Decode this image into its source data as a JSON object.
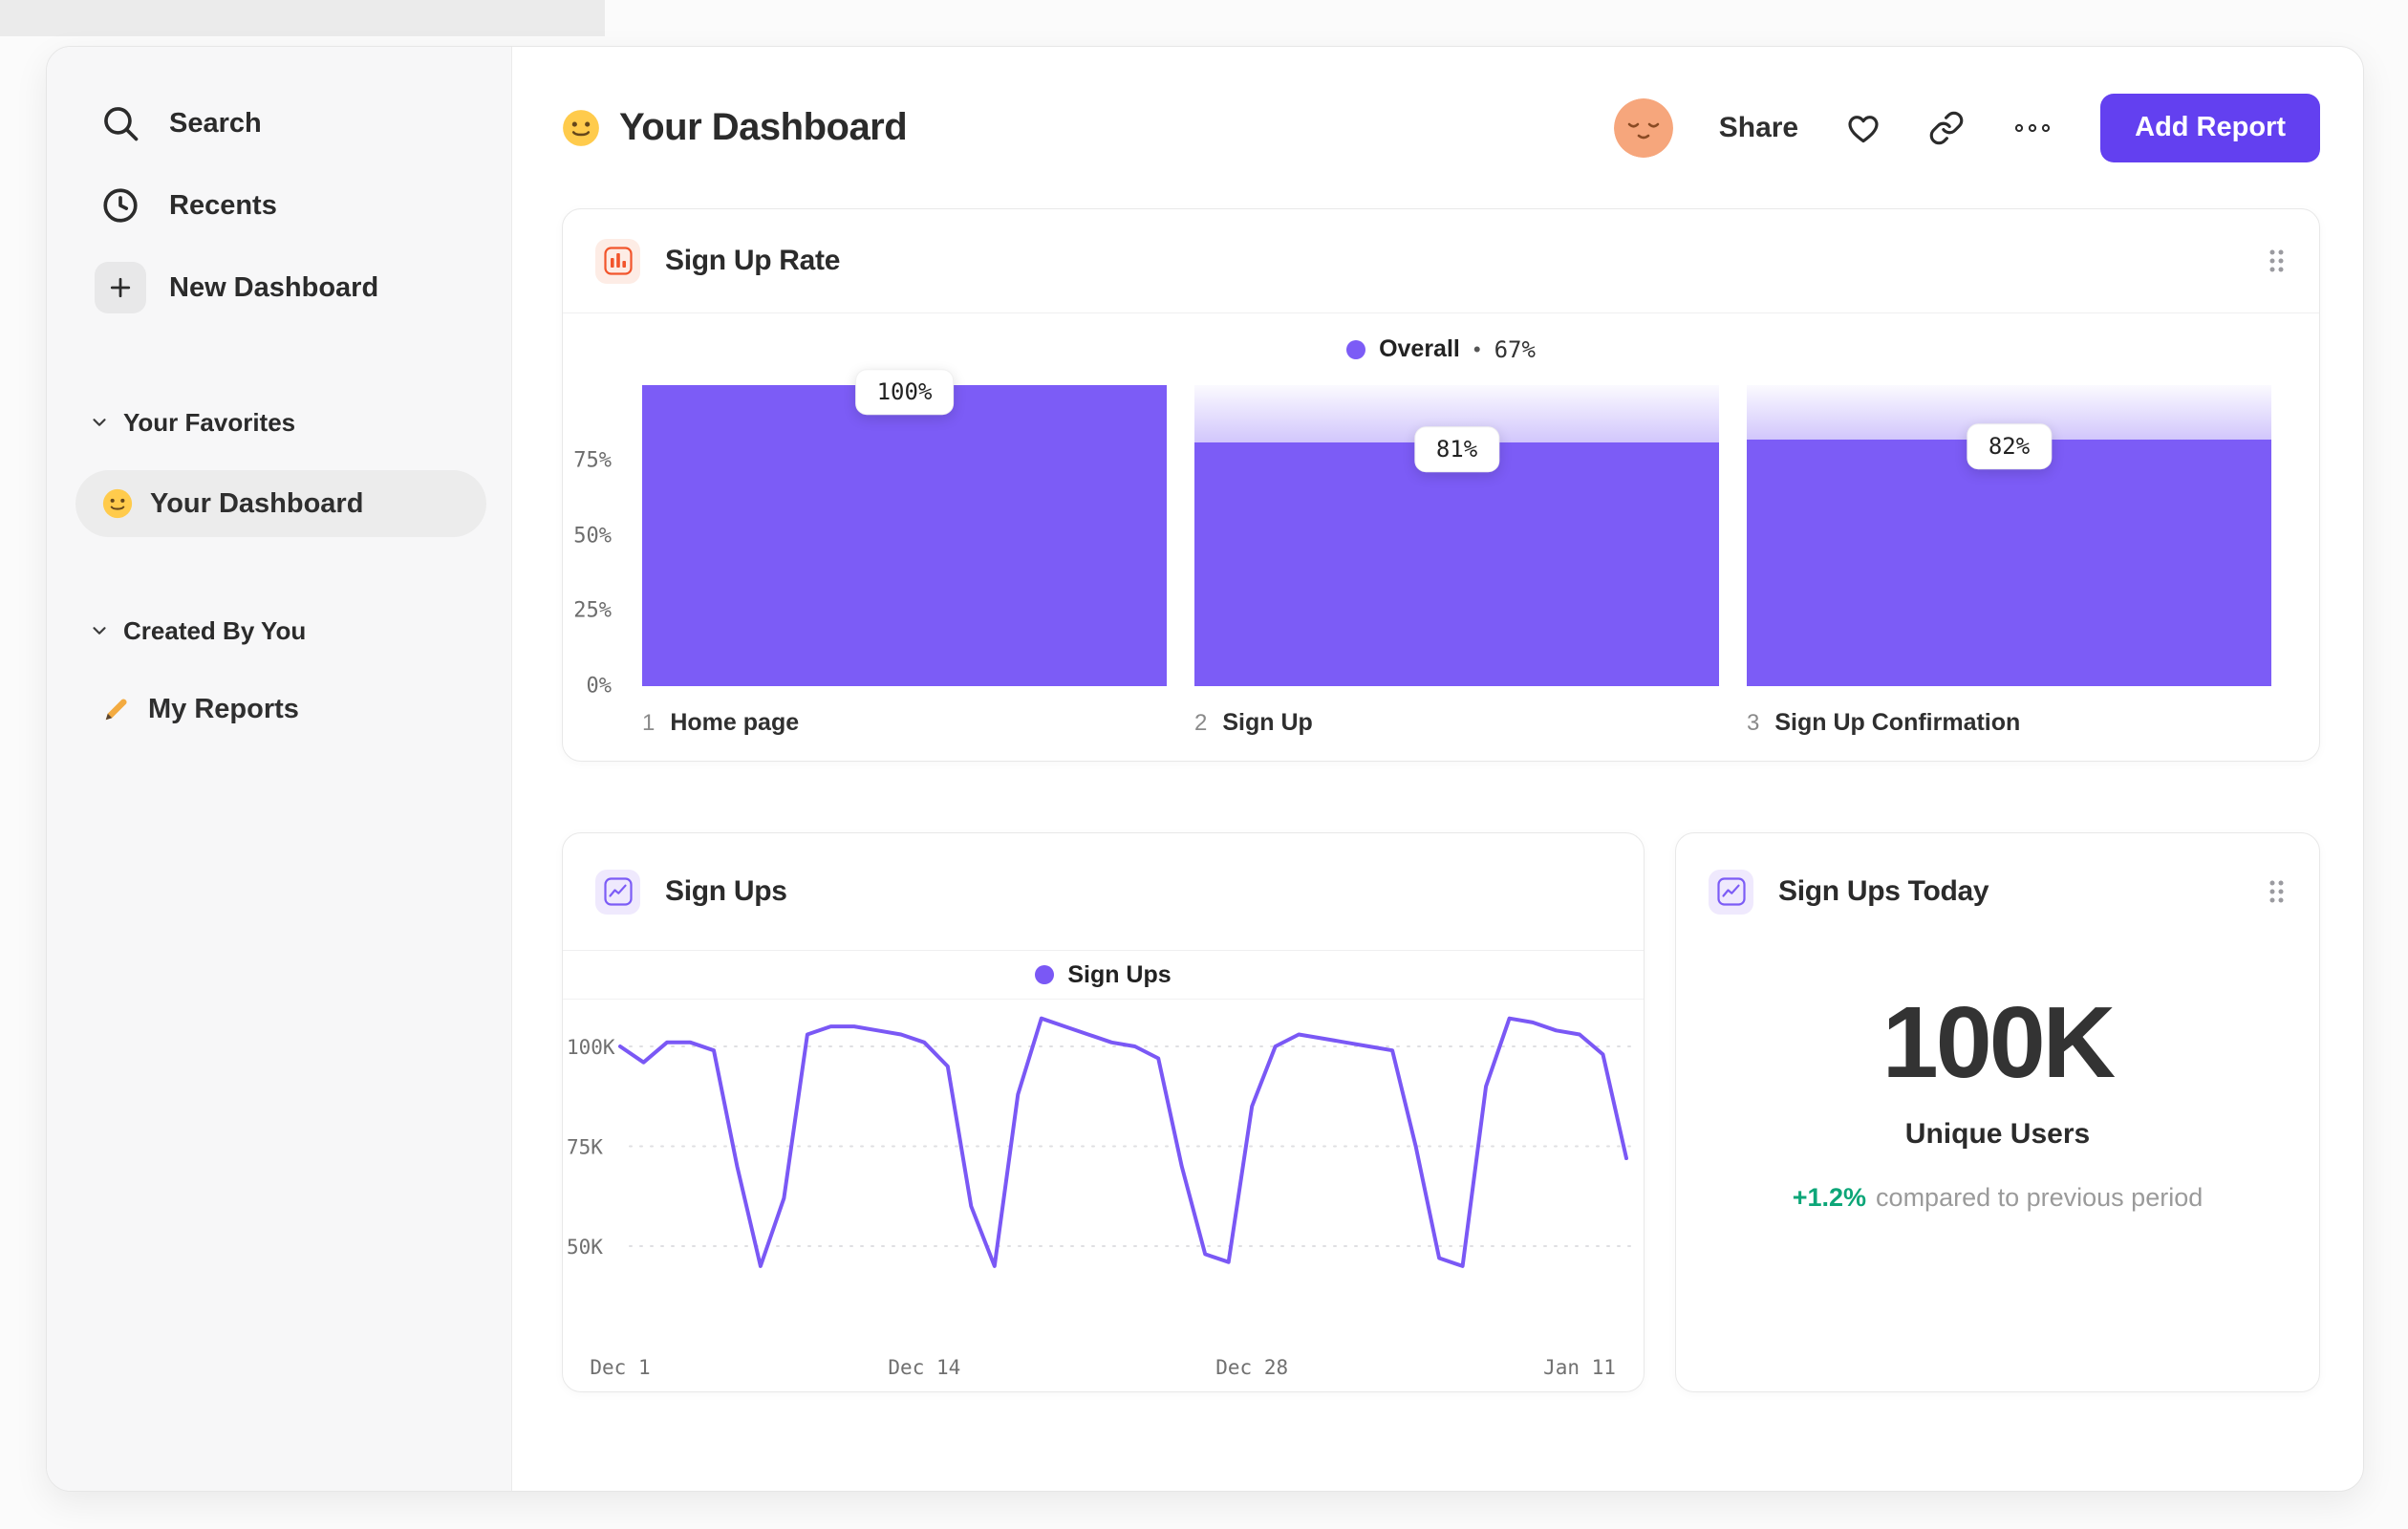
{
  "header": {
    "emoji": "🙂",
    "title": "Your Dashboard",
    "share_label": "Share",
    "add_report_label": "Add Report"
  },
  "sidebar": {
    "nav": [
      {
        "icon": "search-icon",
        "label": "Search"
      },
      {
        "icon": "clock-icon",
        "label": "Recents"
      },
      {
        "icon": "plus-icon",
        "label": "New Dashboard"
      }
    ],
    "sections": [
      {
        "title": "Your Favorites",
        "items": [
          {
            "emoji": "🙂",
            "label": "Your Dashboard",
            "selected": true
          }
        ]
      },
      {
        "title": "Created By You",
        "items": [
          {
            "emoji": "✏️",
            "label": "My Reports",
            "selected": false
          }
        ]
      }
    ]
  },
  "colors": {
    "accent_purple": "#7c5cf6",
    "button_purple": "#6340f0",
    "icon_orange": "#f2552c",
    "delta_green": "#0da678"
  },
  "chart_data": [
    {
      "type": "bar",
      "title": "Sign Up Rate",
      "legend_label": "Overall",
      "legend_separator": "•",
      "legend_value": "67%",
      "categories": [
        "Home page",
        "Sign Up",
        "Sign Up Confirmation"
      ],
      "category_indices": [
        "1",
        "2",
        "3"
      ],
      "values": [
        100,
        81,
        82
      ],
      "value_labels": [
        "100%",
        "81%",
        "82%"
      ],
      "y_ticks": [
        "75%",
        "50%",
        "25%",
        "0%"
      ],
      "ylim": [
        0,
        100
      ],
      "bar_color": "#7c5cf6",
      "legend_position": "top-center",
      "grid": false
    },
    {
      "type": "line",
      "title": "Sign Ups",
      "legend_label": "Sign Ups",
      "x_ticks": [
        "Dec 1",
        "Dec 14",
        "Dec 28",
        "Jan 11"
      ],
      "x_tick_days": [
        0,
        13,
        27,
        41
      ],
      "y_ticks": [
        "100K",
        "75K",
        "50K"
      ],
      "y_tick_values": [
        100,
        75,
        50
      ],
      "unit": "K",
      "values": [
        100,
        96,
        101,
        101,
        99,
        70,
        45,
        62,
        103,
        105,
        105,
        104,
        103,
        101,
        95,
        60,
        45,
        88,
        107,
        105,
        103,
        101,
        100,
        97,
        70,
        48,
        46,
        85,
        100,
        103,
        102,
        101,
        100,
        99,
        75,
        47,
        45,
        90,
        107,
        106,
        104,
        103,
        98,
        72
      ],
      "ylim": [
        26,
        112
      ],
      "line_color": "#7a58f5",
      "grid": "dashed-horizontal",
      "legend_position": "top-center"
    },
    {
      "type": "stat",
      "title": "Sign Ups Today",
      "value": "100K",
      "label": "Unique Users",
      "delta": "+1.2%",
      "delta_note": "compared to previous period",
      "delta_color": "#0da678"
    }
  ]
}
